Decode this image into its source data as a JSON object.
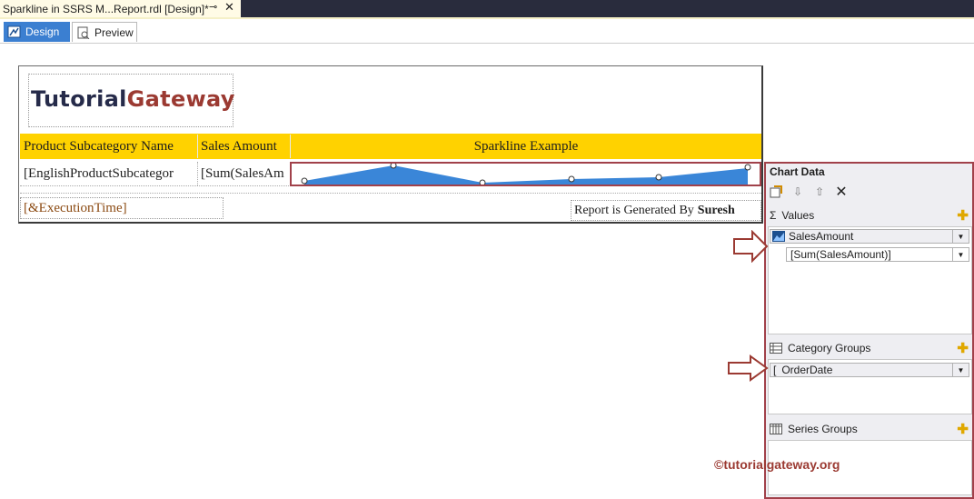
{
  "doc_tab": {
    "title": "Sparkline in SSRS M...Report.rdl [Design]*",
    "pin_icon": "pin-icon",
    "close_icon": "close-icon"
  },
  "view_tabs": [
    {
      "label": "Design",
      "active": true,
      "icon": "design-icon"
    },
    {
      "label": "Preview",
      "active": false,
      "icon": "preview-icon"
    }
  ],
  "report": {
    "logo": {
      "part1": "Tutorial",
      "part2": "Gateway"
    },
    "headers": [
      "Product Subcategory Name",
      "Sales Amount",
      "Sparkline Example"
    ],
    "row": [
      "[EnglishProductSubcategor",
      "[Sum(SalesAm"
    ],
    "footer_left": "[&ExecutionTime]",
    "footer_right_prefix": "Report is Generated By",
    "footer_right_name": "Suresh",
    "header_color": "#ffd200",
    "sparkline_color": "#3a86d8"
  },
  "chart_data_panel": {
    "title": "Chart Data",
    "values": {
      "label": "Values",
      "series_name": "SalesAmount",
      "expression": "[Sum(SalesAmount)]"
    },
    "category_groups": {
      "label": "Category Groups",
      "item": "OrderDate"
    },
    "series_groups": {
      "label": "Series Groups"
    }
  },
  "watermark": "©tutorialgateway.org"
}
